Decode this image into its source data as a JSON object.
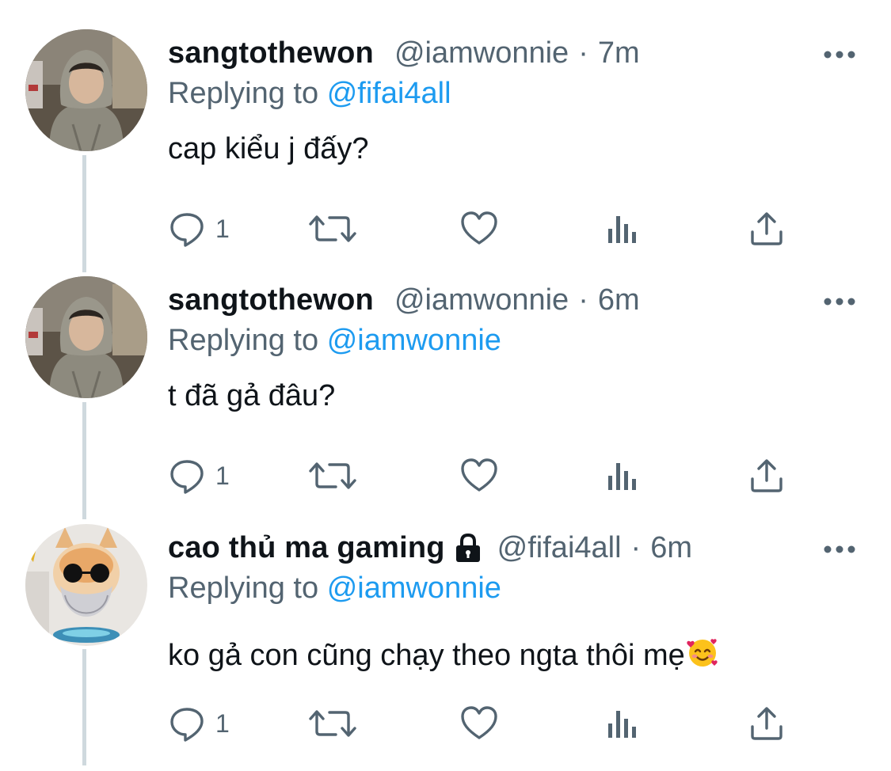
{
  "tweets": [
    {
      "display_name": "sangtothewon",
      "handle": "@iamwonnie",
      "time": "7m",
      "reply_prefix": "Replying to",
      "reply_to": "@fifai4all",
      "text": "cap kiểu j đấy?",
      "reply_count": "1",
      "protected": false,
      "avatar": "person-in-hoodie-photo"
    },
    {
      "display_name": "sangtothewon",
      "handle": "@iamwonnie",
      "time": "6m",
      "reply_prefix": "Replying to",
      "reply_to": "@iamwonnie",
      "text": "t đã gả đâu?",
      "reply_count": "1",
      "protected": false,
      "avatar": "person-in-hoodie-photo"
    },
    {
      "display_name": "cao thủ ma gaming",
      "handle": "@fifai4all",
      "time": "6m",
      "reply_prefix": "Replying to",
      "reply_to": "@iamwonnie",
      "text": "ko gả con cũng chạy theo ngta thôi mẹ",
      "reply_count": "1",
      "protected": true,
      "avatar": "cat-with-sunglasses-photo",
      "trailing_emoji": "smiling-face-with-hearts"
    }
  ],
  "separator": "·",
  "icons": [
    "reply-icon",
    "retweet-icon",
    "like-icon",
    "analytics-icon",
    "share-icon",
    "more-icon",
    "lock-icon"
  ],
  "colors": {
    "text": "#0f1419",
    "secondary": "#536471",
    "link": "#1d9bf0",
    "thread_line": "#cfd9de"
  }
}
